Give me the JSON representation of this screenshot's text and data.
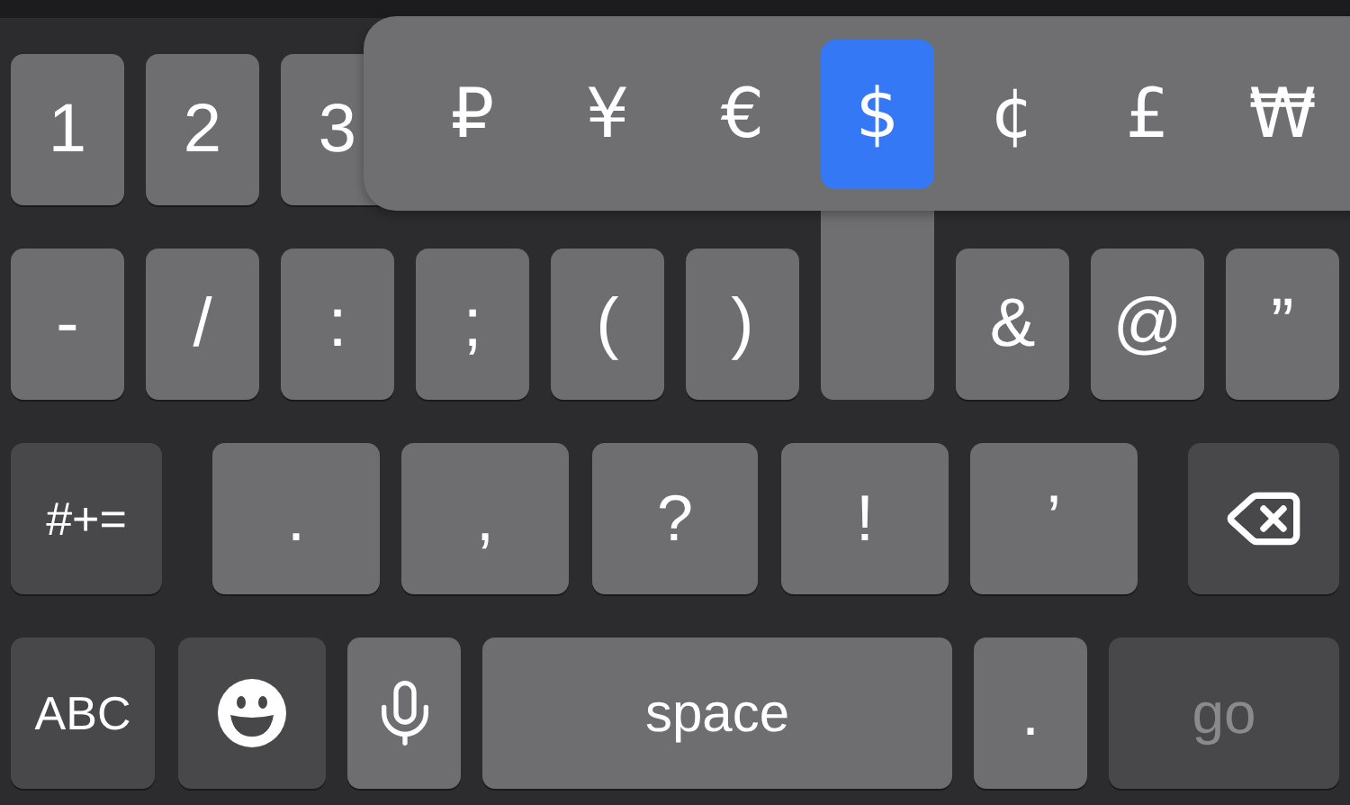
{
  "keyboard": {
    "rows": [
      {
        "keys": [
          {
            "kind": "char",
            "label": "1"
          },
          {
            "kind": "char",
            "label": "2"
          },
          {
            "kind": "char",
            "label": "3"
          }
        ]
      },
      {
        "keys": [
          {
            "kind": "char",
            "label": "-"
          },
          {
            "kind": "char",
            "label": "/"
          },
          {
            "kind": "char",
            "label": ":"
          },
          {
            "kind": "char",
            "label": ";"
          },
          {
            "kind": "char",
            "label": "("
          },
          {
            "kind": "char",
            "label": ")"
          },
          {
            "kind": "pressed"
          },
          {
            "kind": "char",
            "label": "&"
          },
          {
            "kind": "char",
            "label": "@"
          },
          {
            "kind": "char",
            "label": "”"
          }
        ]
      },
      {
        "keys": [
          {
            "kind": "function",
            "label": "#+="
          },
          {
            "kind": "char",
            "label": "."
          },
          {
            "kind": "char",
            "label": ","
          },
          {
            "kind": "char",
            "label": "?"
          },
          {
            "kind": "char",
            "label": "!"
          },
          {
            "kind": "char",
            "label": "’"
          },
          {
            "kind": "backspace"
          }
        ]
      },
      {
        "keys": [
          {
            "kind": "function",
            "label": "ABC",
            "disabled": false
          },
          {
            "kind": "emoji",
            "disabled": false
          },
          {
            "kind": "mic",
            "disabled": false
          },
          {
            "kind": "char",
            "label": "space",
            "disabled": false
          },
          {
            "kind": "char",
            "label": ".",
            "disabled": false
          },
          {
            "kind": "function",
            "label": "go",
            "disabled": true
          }
        ]
      }
    ]
  },
  "popup": {
    "options": [
      {
        "label": "₽",
        "selected": false
      },
      {
        "label": "¥",
        "selected": false
      },
      {
        "label": "€",
        "selected": false
      },
      {
        "label": "$",
        "selected": true
      },
      {
        "label": "¢",
        "selected": false
      },
      {
        "label": "£",
        "selected": false
      },
      {
        "label": "₩",
        "selected": false
      }
    ]
  }
}
